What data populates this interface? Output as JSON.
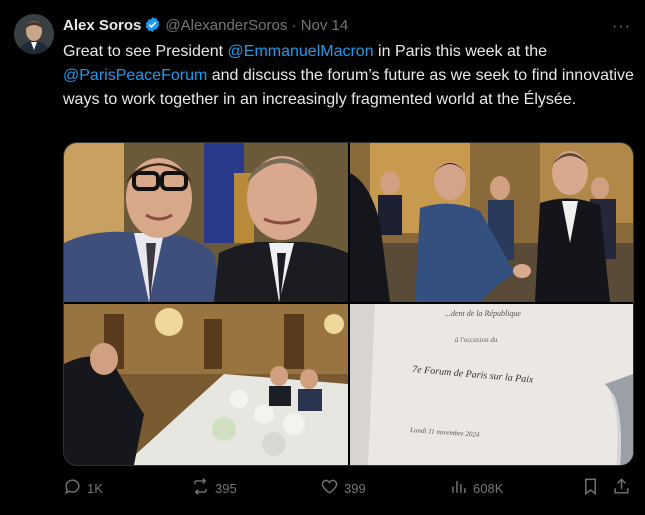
{
  "author": {
    "name": "Alex Soros",
    "handle": "@AlexanderSoros",
    "separator": "·",
    "date": "Nov 14"
  },
  "tweet": {
    "text_1": "Great to see President ",
    "mention_1": "@EmmanuelMacron",
    "text_2": " in Paris this week at the ",
    "mention_2": "@ParisPeaceForum",
    "text_3": " and discuss the forum’s future as we seek to find innovative ways to work together in an increasingly fragmented world at the Élysée."
  },
  "menu": {
    "icon": "more-icon",
    "label": "···"
  },
  "media": {
    "menu_card": {
      "line_1": "...dent de la République",
      "line_2": "à l'occasion du",
      "line_3": "7e Forum de Paris sur la Paix",
      "line_4": "Lundi 11 novembre 2024"
    }
  },
  "actions": {
    "replies": "1K",
    "reposts": "395",
    "likes": "399",
    "views": "608K"
  },
  "colors": {
    "accent": "#1d9bf0",
    "muted": "#71767b",
    "background": "#000000"
  }
}
